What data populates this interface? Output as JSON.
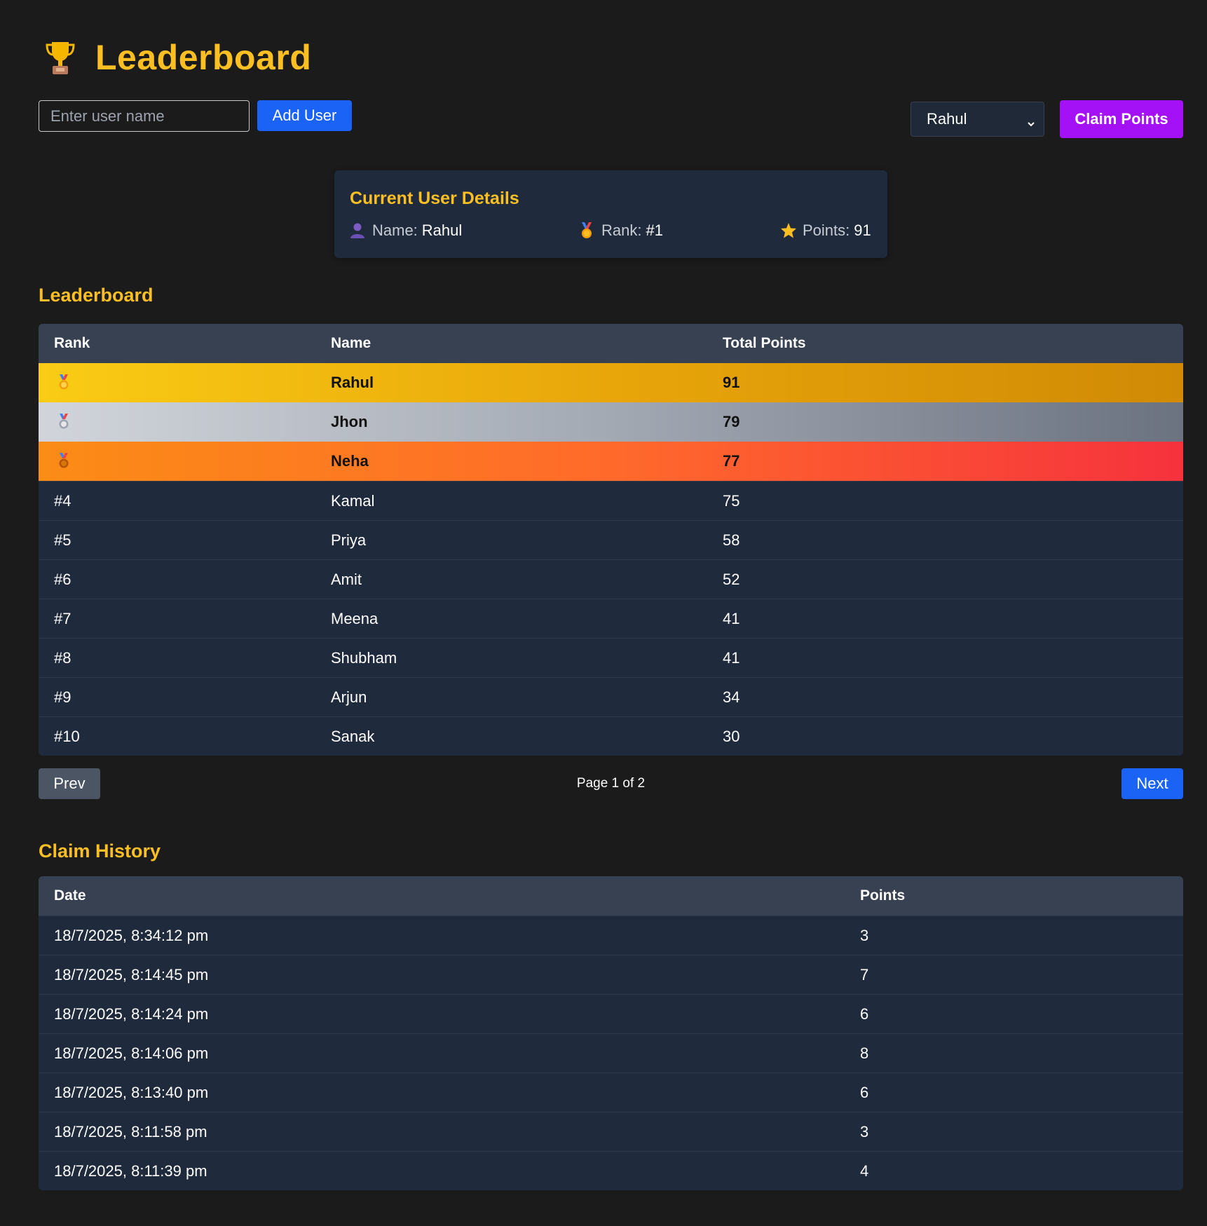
{
  "header": {
    "title": "Leaderboard",
    "icon": "trophy-icon"
  },
  "controls": {
    "name_placeholder": "Enter user name",
    "add_label": "Add User",
    "selected_user": "Rahul",
    "claim_label": "Claim Points"
  },
  "current_user": {
    "title": "Current User Details",
    "name_label": "Name:",
    "name_value": "Rahul",
    "rank_label": "Rank:",
    "rank_value": "#1",
    "points_label": "Points:",
    "points_value": "91"
  },
  "leaderboard": {
    "title": "Leaderboard",
    "headers": [
      "Rank",
      "Name",
      "Total Points"
    ],
    "rows": [
      {
        "rank": "",
        "medal": "gold-medal-icon",
        "name": "Rahul",
        "points": "91"
      },
      {
        "rank": "",
        "medal": "silver-medal-icon",
        "name": "Jhon",
        "points": "79"
      },
      {
        "rank": "",
        "medal": "bronze-medal-icon",
        "name": "Neha",
        "points": "77"
      },
      {
        "rank": "#4",
        "name": "Kamal",
        "points": "75"
      },
      {
        "rank": "#5",
        "name": "Priya",
        "points": "58"
      },
      {
        "rank": "#6",
        "name": "Amit",
        "points": "52"
      },
      {
        "rank": "#7",
        "name": "Meena",
        "points": "41"
      },
      {
        "rank": "#8",
        "name": "Shubham",
        "points": "41"
      },
      {
        "rank": "#9",
        "name": "Arjun",
        "points": "34"
      },
      {
        "rank": "#10",
        "name": "Sanak",
        "points": "30"
      }
    ]
  },
  "pagination": {
    "prev_label": "Prev",
    "page_info": "Page 1 of 2",
    "next_label": "Next"
  },
  "claim_history": {
    "title": "Claim History",
    "headers": [
      "Date",
      "Points"
    ],
    "rows": [
      {
        "date": "18/7/2025, 8:34:12 pm",
        "points": "3"
      },
      {
        "date": "18/7/2025, 8:14:45 pm",
        "points": "7"
      },
      {
        "date": "18/7/2025, 8:14:24 pm",
        "points": "6"
      },
      {
        "date": "18/7/2025, 8:14:06 pm",
        "points": "8"
      },
      {
        "date": "18/7/2025, 8:13:40 pm",
        "points": "6"
      },
      {
        "date": "18/7/2025, 8:11:58 pm",
        "points": "3"
      },
      {
        "date": "18/7/2025, 8:11:39 pm",
        "points": "4"
      }
    ]
  },
  "colors": {
    "accent": "#fbbf24",
    "primary_button": "#1a63f5",
    "claim_button": "#a511f6",
    "card_bg": "#1f2a3c",
    "page_bg": "#1b1b1b"
  }
}
